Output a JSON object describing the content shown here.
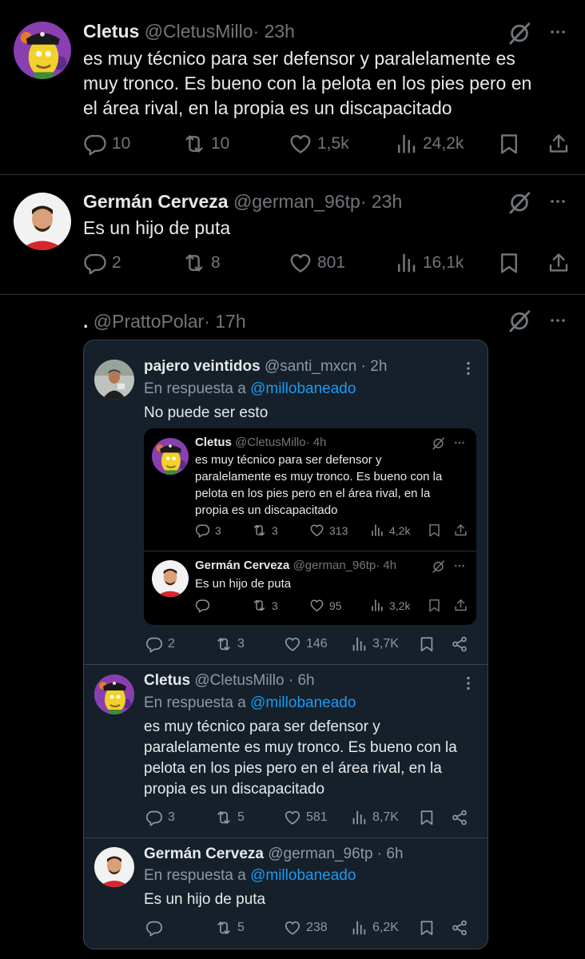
{
  "tweets": [
    {
      "name": "Cletus",
      "handle": "@CletusMillo",
      "time": "· 23h",
      "text_lines": [
        "es muy técnico para ser defensor y paralelamente es",
        "muy tronco. Es bueno con la pelota en los pies pero en",
        "el área rival, en la propia es un discapacitado"
      ],
      "replies": "10",
      "retweets": "10",
      "likes": "1,5k",
      "views": "24,2k"
    },
    {
      "name": "Germán Cerveza",
      "handle": "@german_96tp",
      "time": "· 23h",
      "text_lines": [
        "Es un hijo de puta"
      ],
      "replies": "2",
      "retweets": "8",
      "likes": "801",
      "views": "16,1k"
    },
    {
      "name": ".",
      "handle": "@PrattoPolar",
      "time": "· 17h"
    }
  ],
  "card": {
    "posts": [
      {
        "name": "pajero veintidos",
        "handle": "@santi_mxcn",
        "time": "· 2h",
        "reply_prefix": "En respuesta a",
        "reply_to": "@millobaneado",
        "text_lines": [
          "No puede ser esto"
        ],
        "replies": "2",
        "retweets": "3",
        "likes": "146",
        "views": "3,7K"
      },
      {
        "name": "Cletus",
        "handle": "@CletusMillo",
        "time": "· 6h",
        "reply_prefix": "En respuesta a",
        "reply_to": "@millobaneado",
        "text_lines": [
          "es muy técnico para ser defensor y",
          "paralelamente es muy tronco. Es bueno con la",
          "pelota en los pies pero en el área rival, en la",
          "propia es un discapacitado"
        ],
        "replies": "3",
        "retweets": "5",
        "likes": "581",
        "views": "8,7K"
      },
      {
        "name": "Germán Cerveza",
        "handle": "@german_96tp",
        "time": "· 6h",
        "reply_prefix": "En respuesta a",
        "reply_to": "@millobaneado",
        "text_lines": [
          "Es un hijo de puta"
        ],
        "replies": "",
        "retweets": "5",
        "likes": "238",
        "views": "6,2K"
      }
    ],
    "inner": [
      {
        "name": "Cletus",
        "handle": "@CletusMillo",
        "time": "· 4h",
        "text_lines": [
          "es muy técnico para ser defensor y",
          "paralelamente es muy tronco. Es bueno con la",
          "pelota en los pies pero en el área rival, en la",
          "propia es un discapacitado"
        ],
        "replies": "3",
        "retweets": "3",
        "likes": "313",
        "views": "4,2k"
      },
      {
        "name": "Germán Cerveza",
        "handle": "@german_96tp",
        "time": "· 4h",
        "text_lines": [
          "Es un hijo de puta"
        ],
        "replies": "",
        "retweets": "3",
        "likes": "95",
        "views": "3,2k"
      }
    ]
  },
  "icons": {
    "reply": "reply-icon",
    "retweet": "retweet-icon",
    "like": "heart-icon",
    "views": "views-icon",
    "bookmark": "bookmark-icon",
    "share": "share-icon",
    "grok": "grok-icon",
    "more": "more-icon"
  },
  "colors": {
    "background": "#000000",
    "card_background": "#15202b",
    "link": "#1d9bf0",
    "text": "#e7e9ea",
    "muted": "#71767b"
  }
}
